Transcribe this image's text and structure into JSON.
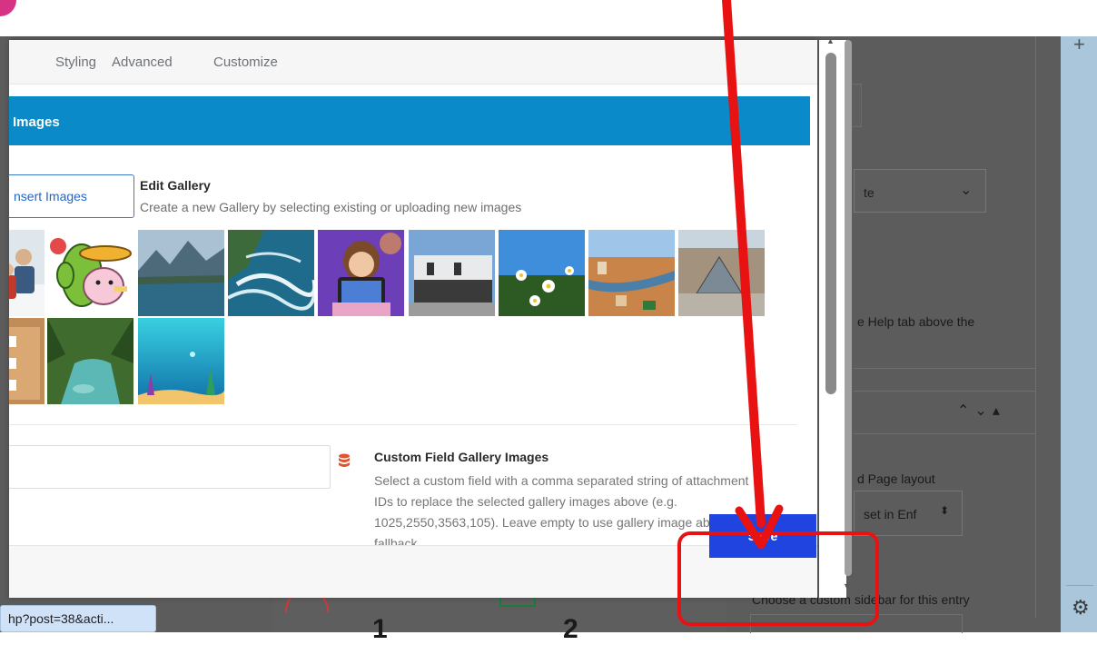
{
  "modal": {
    "tabs": [
      {
        "label": "Styling"
      },
      {
        "label": "Advanced"
      },
      {
        "label": "Customize"
      }
    ],
    "section_title": "Images",
    "insert_images_label": "nsert Images",
    "edit_gallery": {
      "title": "Edit Gallery",
      "description": "Create a new Gallery by selecting existing or uploading new images"
    },
    "custom_field_gallery": {
      "title": "Custom Field Gallery Images",
      "description": "Select a custom field with a comma separated string of attachment IDs to replace the selected gallery images above (e.g. 1025,2550,3563,105). Leave empty to use gallery image above as fallback",
      "input_value": ""
    },
    "save_label": "Save"
  },
  "gallery": {
    "images": [
      {
        "name": "snow-kids"
      },
      {
        "name": "cactus-axolotl"
      },
      {
        "name": "mountain-lake"
      },
      {
        "name": "coastline-waves"
      },
      {
        "name": "girl-tablet"
      },
      {
        "name": "modern-building"
      },
      {
        "name": "daisies-sky"
      },
      {
        "name": "river-city"
      },
      {
        "name": "louvre-pyramid"
      },
      {
        "name": "old-town-building"
      },
      {
        "name": "forest-river"
      },
      {
        "name": "underwater-scene"
      }
    ]
  },
  "status_bar": {
    "url_text": "hp?post=38&acti..."
  },
  "background": {
    "select_text": "te",
    "help_text": "e Help tab above the",
    "page_layout_text": "d Page layout",
    "layout_select_text": "set in Enf",
    "custom_sidebar_text": "Choose a custom sidebar for this entry",
    "num_1": "1",
    "num_2": "2"
  },
  "colors": {
    "accent_header": "#0a8ac8",
    "save_button": "#1f44e0",
    "annotation_red": "#e81212",
    "db_icon": "#e0552d"
  }
}
